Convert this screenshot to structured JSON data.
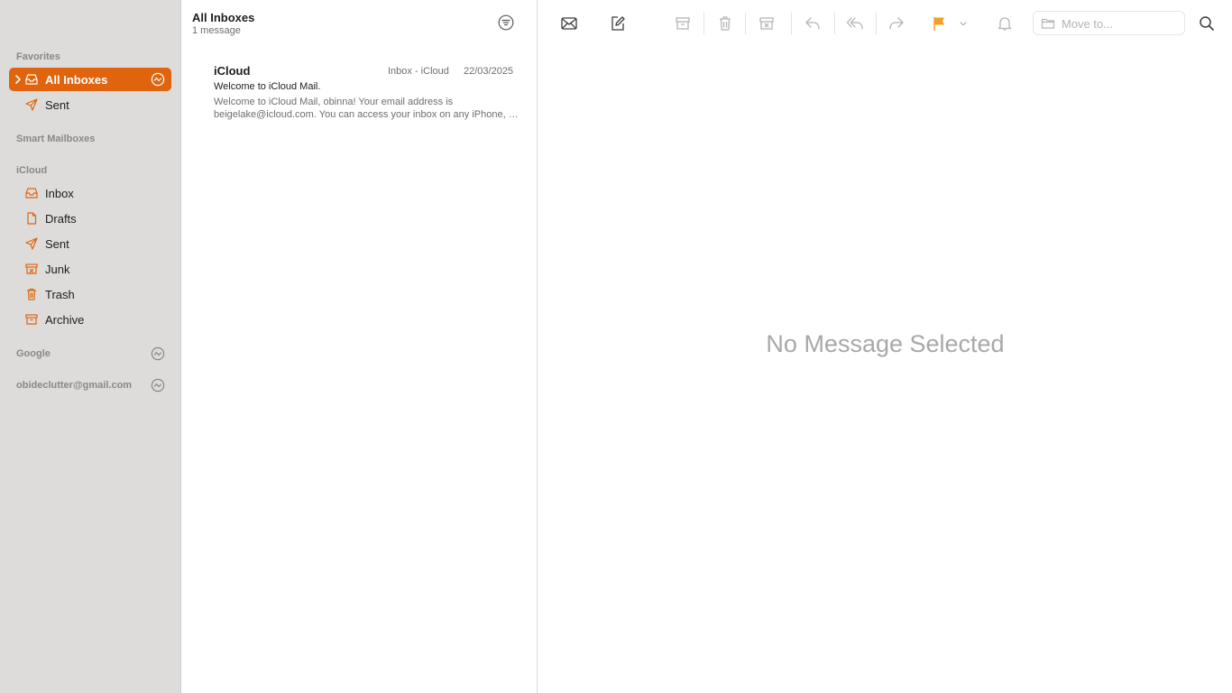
{
  "sidebar": {
    "favorites_title": "Favorites",
    "favorites": [
      {
        "label": "All Inboxes",
        "icon": "tray-icon"
      },
      {
        "label": "Sent",
        "icon": "paperplane-icon"
      }
    ],
    "smart_mailboxes_title": "Smart Mailboxes",
    "icloud_title": "iCloud",
    "icloud": [
      {
        "label": "Inbox",
        "icon": "tray-icon"
      },
      {
        "label": "Drafts",
        "icon": "document-icon"
      },
      {
        "label": "Sent",
        "icon": "paperplane-icon"
      },
      {
        "label": "Junk",
        "icon": "junk-icon"
      },
      {
        "label": "Trash",
        "icon": "trash-icon"
      },
      {
        "label": "Archive",
        "icon": "archive-icon"
      }
    ],
    "google_title": "Google",
    "gmail_title": "obideclutter@gmail.com"
  },
  "list": {
    "title": "All Inboxes",
    "subtitle": "1 message",
    "messages": [
      {
        "from": "iCloud",
        "mailbox": "Inbox - iCloud",
        "date": "22/03/2025",
        "subject": "Welcome to iCloud Mail.",
        "preview_line1": "Welcome to iCloud Mail, obinna! Your email address is",
        "preview_line2": "beigelake@icloud.com. You can access your inbox on any iPhone, iPad, Mac or PC."
      }
    ]
  },
  "toolbar": {
    "move_to_placeholder": "Move to..."
  },
  "viewer": {
    "empty_text": "No Message Selected"
  },
  "colors": {
    "accent": "#e0640e",
    "flag": "#f6a020",
    "sidebar_bg": "#dedcda"
  }
}
